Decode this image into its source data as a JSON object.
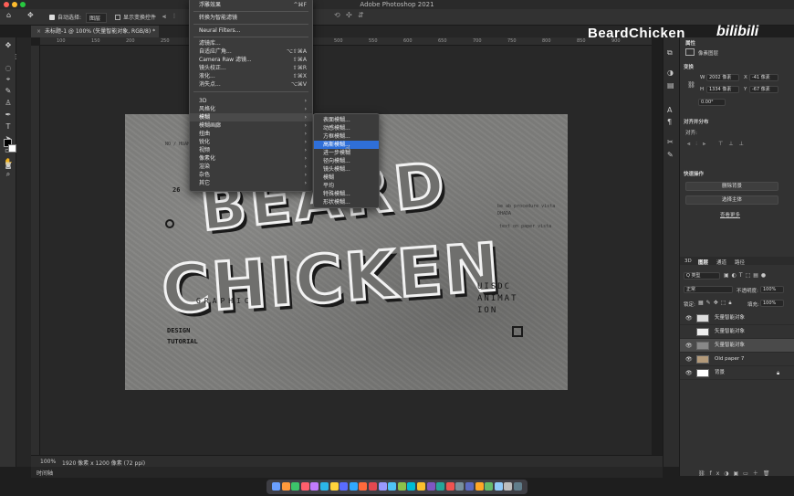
{
  "app": {
    "title": "Adobe Photoshop 2021"
  },
  "options_bar": {
    "auto_select_label": "自动选择:",
    "auto_select_value": "图层",
    "show_transform_label": "显示变换控件"
  },
  "document": {
    "tab_label": "未标题-1 @ 100% (矢量智能对象, RGB/8) *",
    "zoom": "100%",
    "size_info": "1920 像素 x 1200 像素 (72 ppi)"
  },
  "ruler": {
    "ticks": [
      "100",
      "150",
      "200",
      "250",
      "300",
      "350",
      "400",
      "450",
      "500",
      "550",
      "600",
      "650",
      "700",
      "750",
      "800",
      "850",
      "900"
    ]
  },
  "filter_menu": {
    "items": [
      {
        "label": "浮雕效果",
        "shortcut": "^⌘F"
      },
      {
        "label": "转换为智能滤镜",
        "shortcut": ""
      },
      {
        "label": "Neural Filters...",
        "shortcut": ""
      },
      {
        "label": "滤镜库...",
        "shortcut": ""
      },
      {
        "label": "自适应广角...",
        "shortcut": "⌥⇧⌘A"
      },
      {
        "label": "Camera Raw 滤镜...",
        "shortcut": "⇧⌘A"
      },
      {
        "label": "镜头校正...",
        "shortcut": "⇧⌘R"
      },
      {
        "label": "液化...",
        "shortcut": "⇧⌘X"
      },
      {
        "label": "消失点...",
        "shortcut": "⌥⌘V"
      },
      {
        "label": "3D",
        "shortcut": "›"
      },
      {
        "label": "风格化",
        "shortcut": "›"
      },
      {
        "label": "模糊",
        "shortcut": "›"
      },
      {
        "label": "模糊画廊",
        "shortcut": "›"
      },
      {
        "label": "扭曲",
        "shortcut": "›"
      },
      {
        "label": "锐化",
        "shortcut": "›"
      },
      {
        "label": "视频",
        "shortcut": "›"
      },
      {
        "label": "像素化",
        "shortcut": "›"
      },
      {
        "label": "渲染",
        "shortcut": "›"
      },
      {
        "label": "杂色",
        "shortcut": "›"
      },
      {
        "label": "其它",
        "shortcut": "›"
      }
    ]
  },
  "blur_submenu": {
    "items": [
      "表面模糊...",
      "动感模糊...",
      "方框模糊...",
      "高斯模糊...",
      "进一步模糊",
      "径向模糊...",
      "镜头模糊...",
      "模糊",
      "平均",
      "特殊模糊...",
      "形状模糊..."
    ],
    "highlighted": "高斯模糊..."
  },
  "canvas": {
    "line1": "BEARD",
    "line2": "CHICKEN",
    "graphic": "GRAPHIC",
    "design": "DESIGN",
    "tutorial": "TUTORIAL",
    "uisdc1": "UISDC",
    "uisdc2": "ANIMAT",
    "uisdc3": "ION",
    "num": "26",
    "small1": "NO / HUAHUA",
    "small2": "text on paper",
    "small3": "be ab procedure vista",
    "small4": "DHADA",
    "small5": "text on paper vista"
  },
  "properties": {
    "tab_title": "属性",
    "subtitle": "像素图层",
    "transform_title": "变换",
    "w_label": "W",
    "w_value": "2002 像素",
    "x_label": "X",
    "x_value": "-41 像素",
    "h_label": "H",
    "h_value": "1334 像素",
    "y_label": "Y",
    "y_value": "-67 像素",
    "angle": "0.00°",
    "align_title": "对齐并分布",
    "align_label": "对齐:",
    "quick_title": "快速操作",
    "btn_remove_bg": "删除背景",
    "btn_select_subject": "选择主体",
    "learn_more": "查看更多"
  },
  "layers_panel": {
    "tabs": [
      "3D",
      "图层",
      "通道",
      "路径"
    ],
    "kind_filter": "Q 类型",
    "blend_mode": "正常",
    "opacity_label": "不透明度:",
    "opacity_value": "100%",
    "lock_label": "锁定:",
    "fill_label": "填充:",
    "fill_value": "100%",
    "layers": [
      {
        "name": "矢量智能对象",
        "visible": true
      },
      {
        "name": "矢量智能对象",
        "visible": false
      },
      {
        "name": "矢量智能对象",
        "visible": true,
        "selected": true
      },
      {
        "name": "Old paper 7",
        "visible": true
      },
      {
        "name": "背景",
        "visible": true
      }
    ]
  },
  "status": {
    "timeline": "时间轴"
  },
  "watermark": {
    "text": "BeardChicken",
    "brand": "bilibili"
  }
}
